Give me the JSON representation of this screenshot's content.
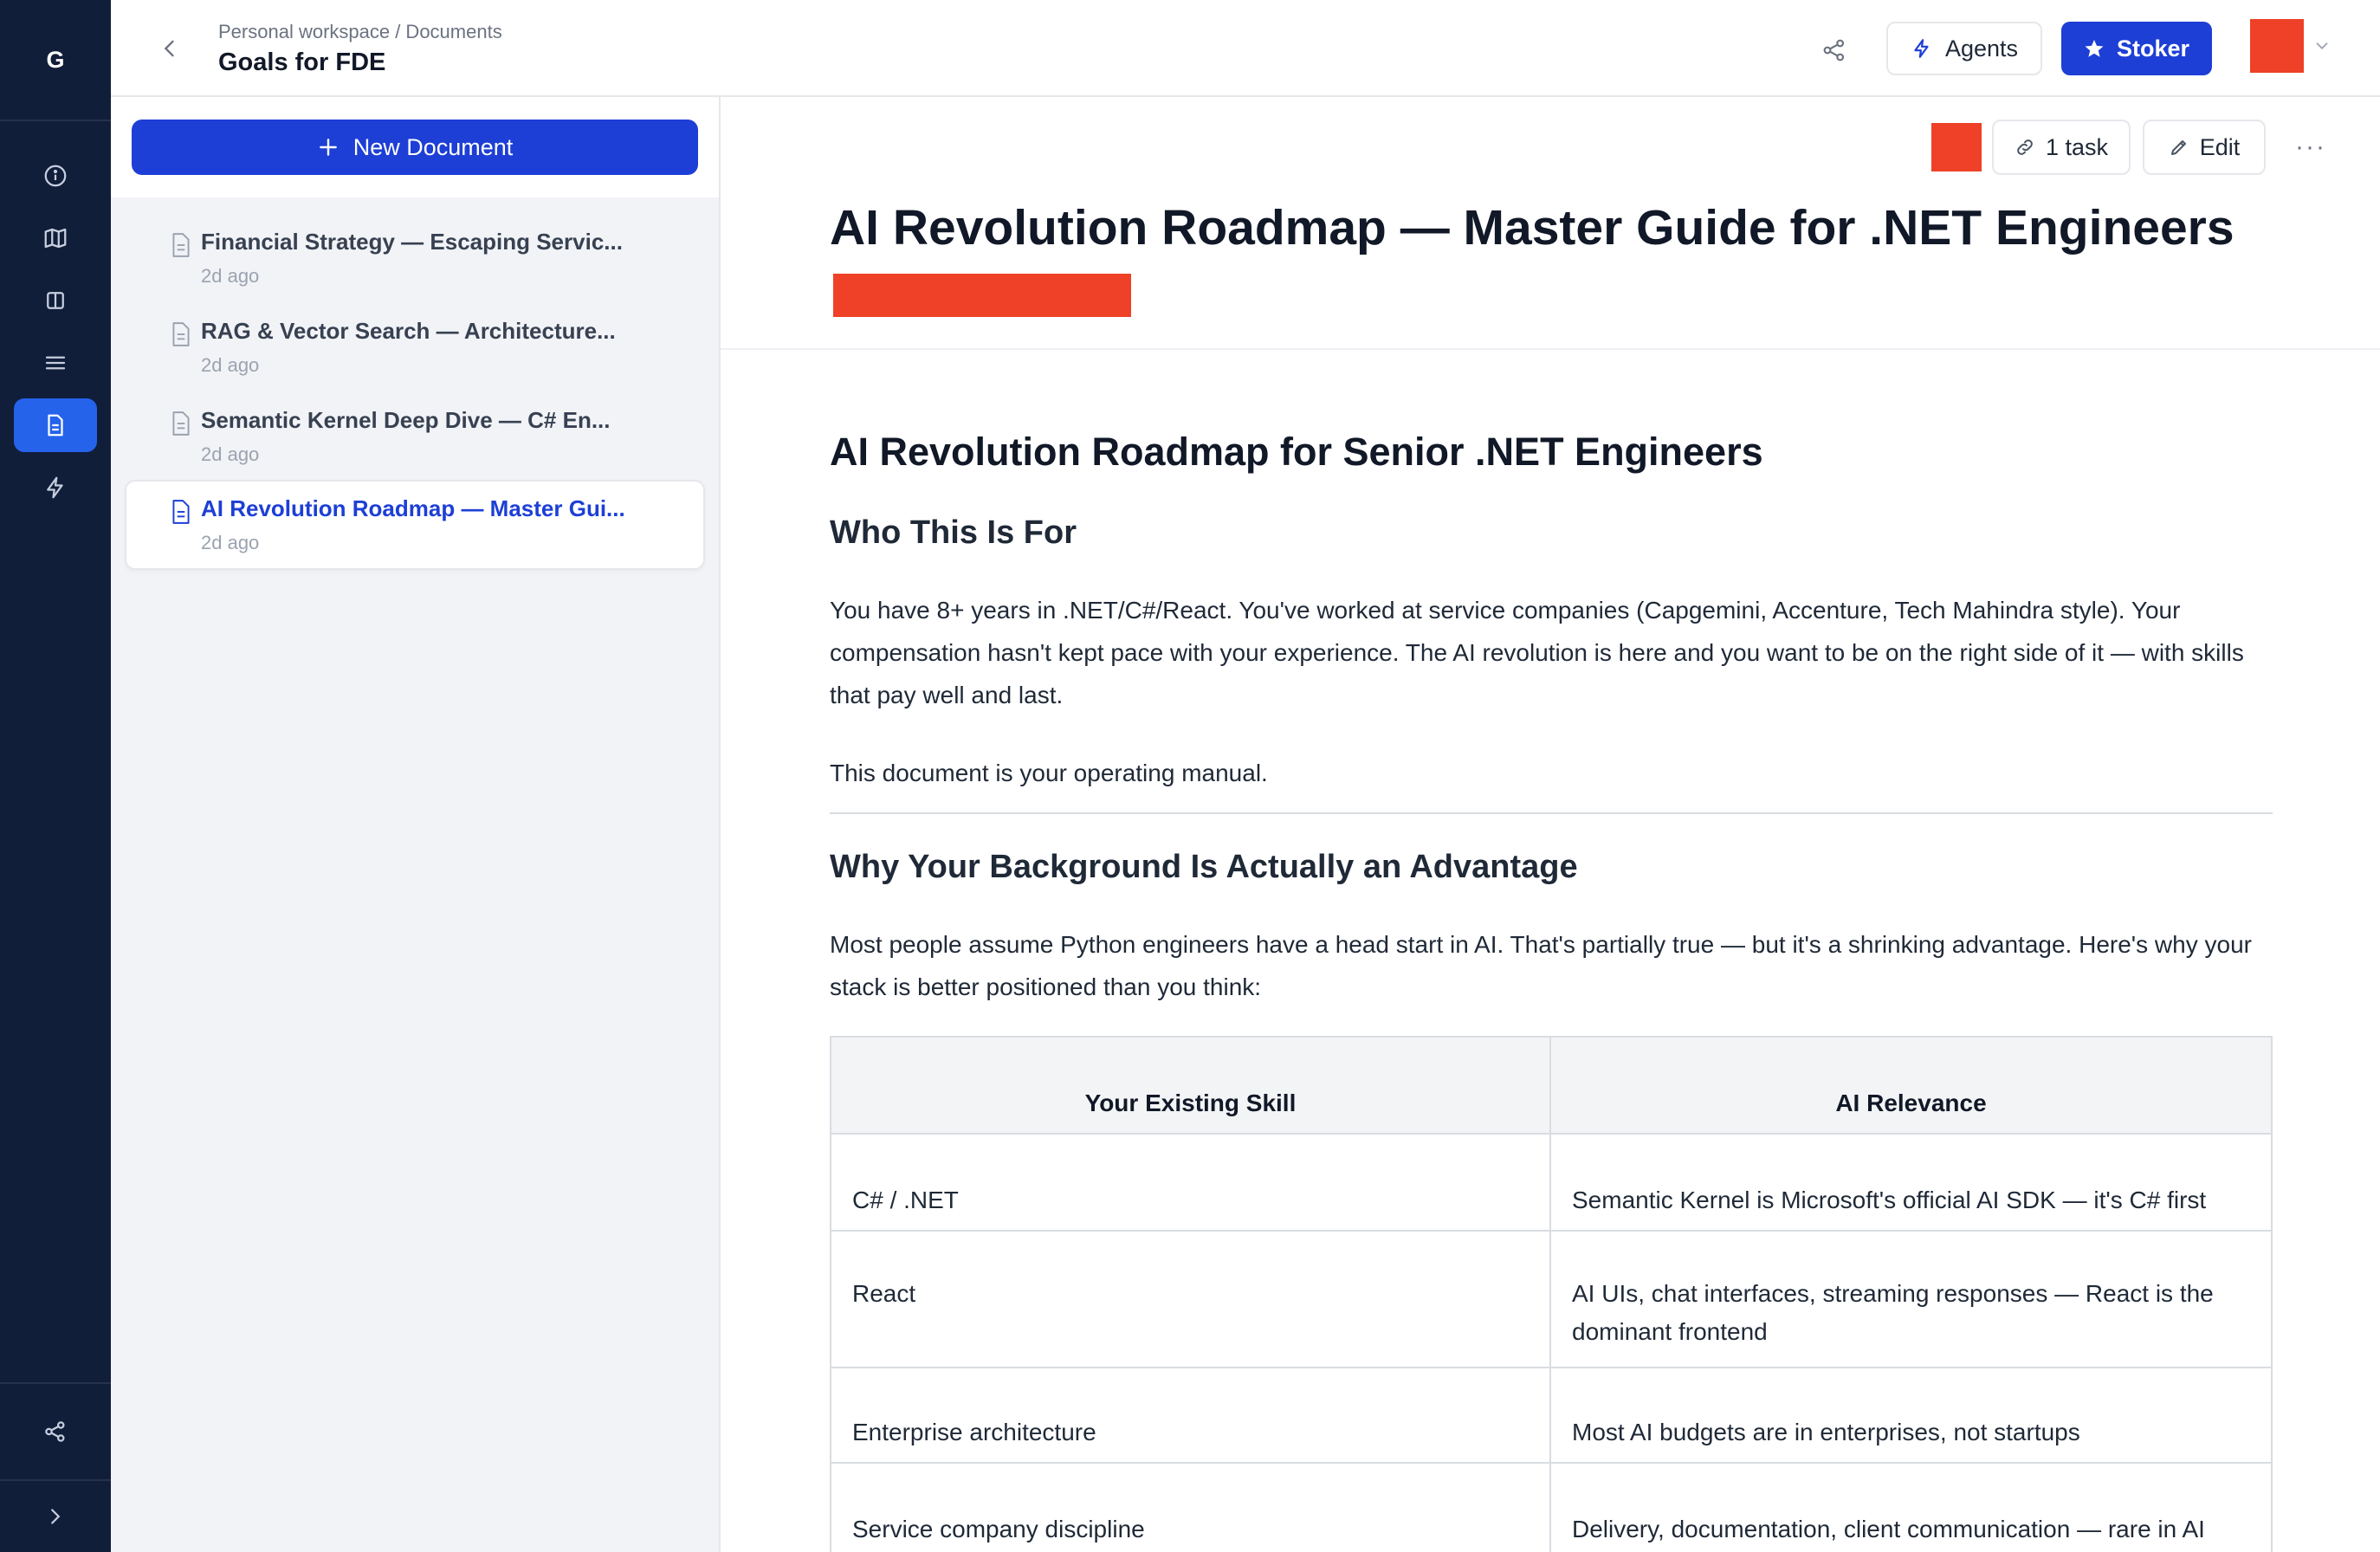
{
  "app": {
    "logo_letter": "G"
  },
  "header": {
    "breadcrumb": "Personal workspace / Documents",
    "title": "Goals for FDE",
    "agents_label": "Agents",
    "stoker_label": "Stoker"
  },
  "sidebar": {
    "new_document_label": "New Document",
    "documents": [
      {
        "title": "Financial Strategy — Escaping Servic...",
        "time": "2d ago"
      },
      {
        "title": "RAG & Vector Search — Architecture...",
        "time": "2d ago"
      },
      {
        "title": "Semantic Kernel Deep Dive — C# En...",
        "time": "2d ago"
      },
      {
        "title": "AI Revolution Roadmap — Master Gui...",
        "time": "2d ago",
        "active": true
      }
    ]
  },
  "document": {
    "task_label": "1 task",
    "edit_label": "Edit",
    "more_label": "···",
    "title": "AI Revolution Roadmap — Master Guide for .NET Engineers",
    "h1": "AI Revolution Roadmap for Senior .NET Engineers",
    "section1_heading": "Who This Is For",
    "section1_para1": "You have 8+ years in .NET/C#/React. You've worked at service companies (Capgemini, Accenture, Tech Mahindra style). Your compensation hasn't kept pace with your experience. The AI revolution is here and you want to be on the right side of it — with skills that pay well and last.",
    "section1_para2": "This document is your operating manual.",
    "section2_heading": "Why Your Background Is Actually an Advantage",
    "section2_para": "Most people assume Python engineers have a head start in AI. That's partially true — but it's a shrinking advantage. Here's why your stack is better positioned than you think:",
    "table": {
      "headers": [
        "Your Existing Skill",
        "AI Relevance"
      ],
      "rows": [
        [
          "C# / .NET",
          "Semantic Kernel is Microsoft's official AI SDK — it's C# first"
        ],
        [
          "React",
          "AI UIs, chat interfaces, streaming responses — React is the dominant frontend"
        ],
        [
          "Enterprise architecture",
          "Most AI budgets are in enterprises, not startups"
        ],
        [
          "Service company discipline",
          "Delivery, documentation, client communication — rare in AI"
        ]
      ]
    }
  },
  "colors": {
    "accent": "#1d3fd6",
    "rail": "#111e3a",
    "redacted": "#ee4127"
  }
}
